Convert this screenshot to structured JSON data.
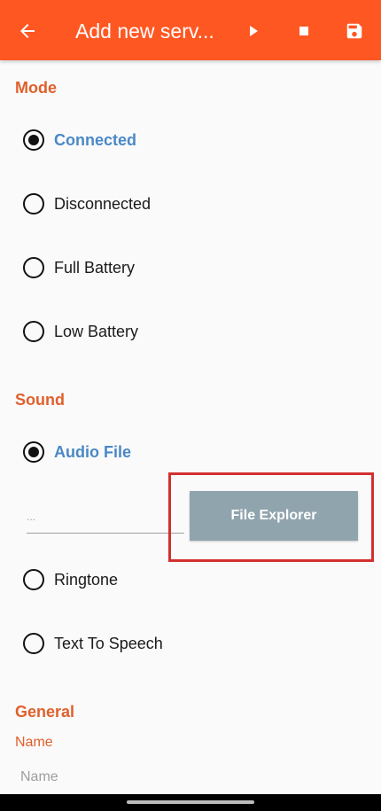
{
  "app_bar": {
    "title": "Add new serv...",
    "background": "#ff5722",
    "icons": {
      "back": "arrow-back-icon",
      "play": "play-icon",
      "stop": "stop-icon",
      "save": "save-icon"
    }
  },
  "mode": {
    "header": "Mode",
    "options": [
      {
        "label": "Connected",
        "selected": true
      },
      {
        "label": "Disconnected",
        "selected": false
      },
      {
        "label": "Full Battery",
        "selected": false
      },
      {
        "label": "Low Battery",
        "selected": false
      }
    ]
  },
  "sound": {
    "header": "Sound",
    "audio_file": {
      "label": "Audio File",
      "selected": true
    },
    "file_path_value": "...",
    "file_explorer_label": "File Explorer",
    "ringtone": {
      "label": "Ringtone",
      "selected": false
    },
    "tts": {
      "label": "Text To Speech",
      "selected": false
    }
  },
  "general": {
    "header": "General",
    "name_label": "Name",
    "name_placeholder": "Name"
  },
  "colors": {
    "accent": "#e0602c",
    "selected_text": "#4a88c6",
    "button": "#90a4ae",
    "highlight": "#d32f2f"
  }
}
